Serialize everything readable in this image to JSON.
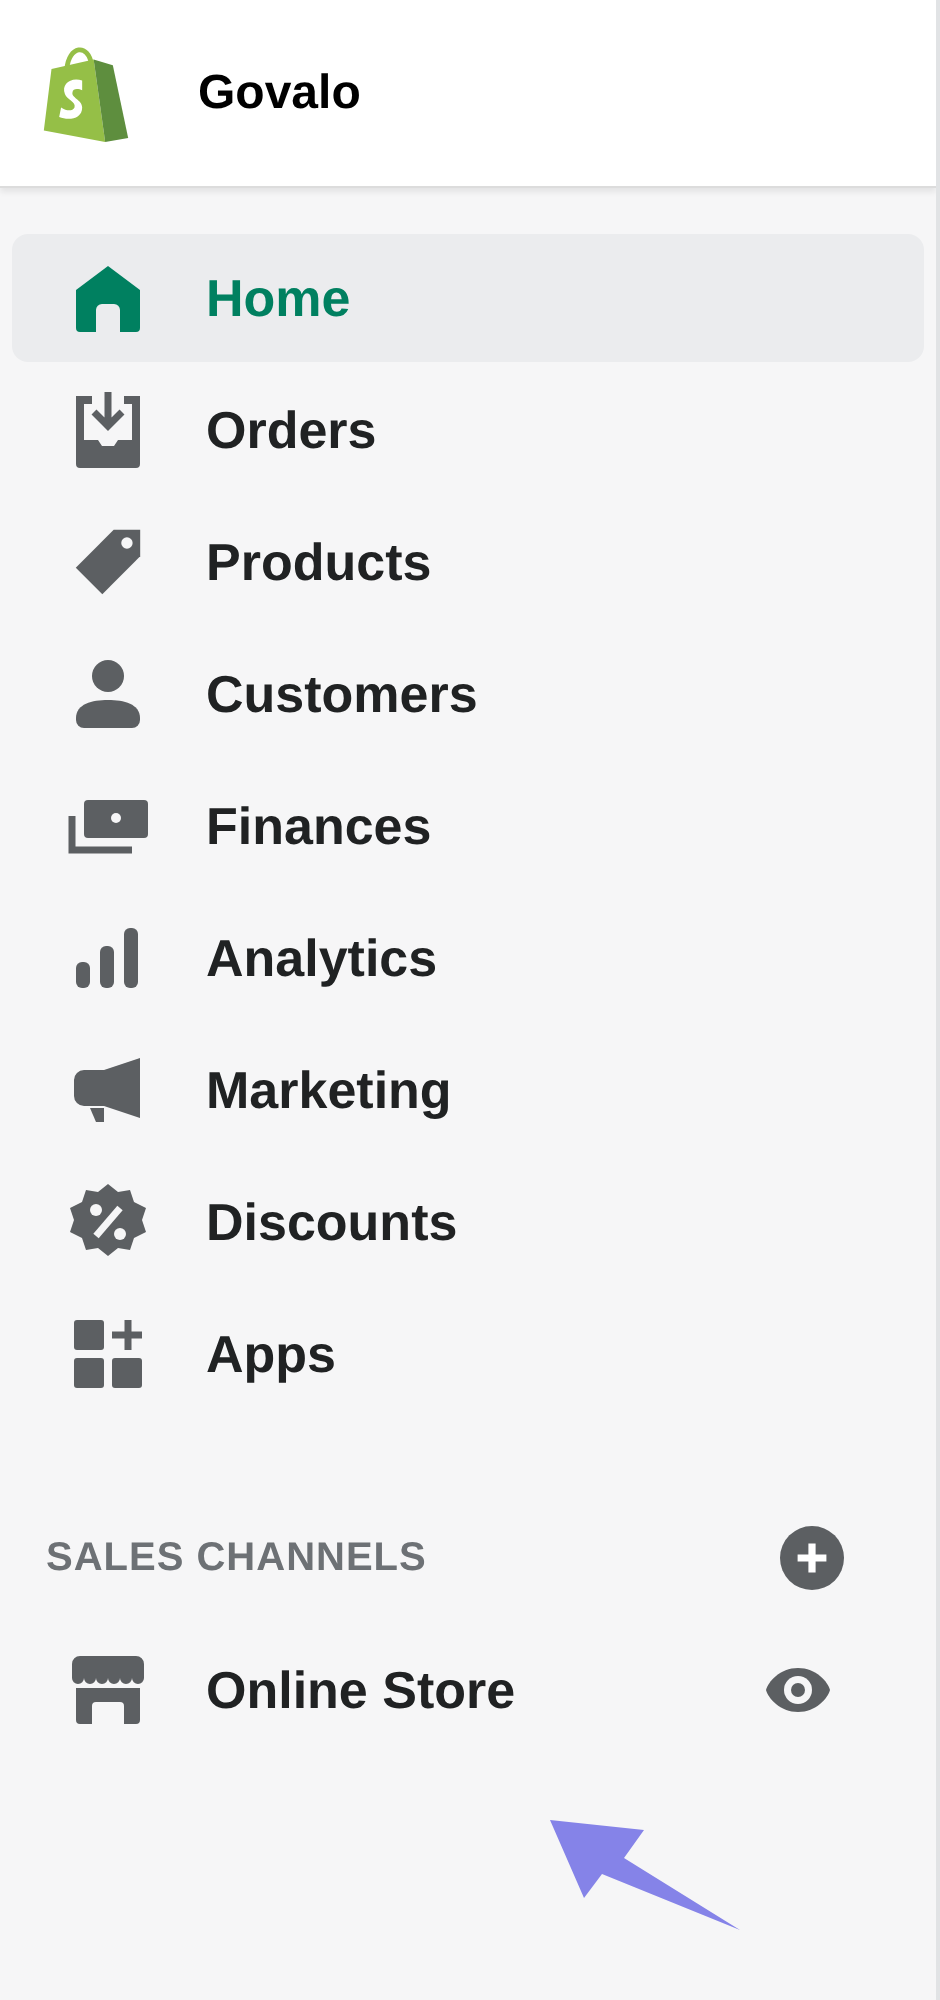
{
  "header": {
    "store_name": "Govalo"
  },
  "nav": [
    {
      "label": "Home",
      "selected": true
    },
    {
      "label": "Orders",
      "selected": false
    },
    {
      "label": "Products",
      "selected": false
    },
    {
      "label": "Customers",
      "selected": false
    },
    {
      "label": "Finances",
      "selected": false
    },
    {
      "label": "Analytics",
      "selected": false
    },
    {
      "label": "Marketing",
      "selected": false
    },
    {
      "label": "Discounts",
      "selected": false
    },
    {
      "label": "Apps",
      "selected": false
    }
  ],
  "sales_channels": {
    "heading": "SALES CHANNELS",
    "items": [
      {
        "label": "Online Store",
        "selected": false
      }
    ]
  }
}
